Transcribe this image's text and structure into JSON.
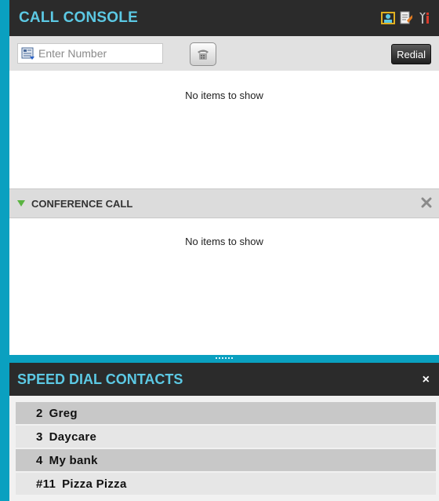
{
  "call_console": {
    "title": "CALL CONSOLE",
    "header_icons": [
      "agent-status-icon",
      "notes-icon",
      "settings-icon"
    ],
    "number_input": {
      "placeholder": "Enter Number",
      "value": ""
    },
    "redial_label": "Redial",
    "empty_text": "No items to show"
  },
  "conference": {
    "title": "CONFERENCE CALL",
    "empty_text": "No items to show"
  },
  "speed_dial": {
    "title": "SPEED DIAL CONTACTS",
    "close_label": "×",
    "contacts": [
      {
        "number": "2",
        "name": "Greg"
      },
      {
        "number": "3",
        "name": "Daycare"
      },
      {
        "number": "4",
        "name": "My bank"
      },
      {
        "number": "#11",
        "name": "Pizza Pizza"
      }
    ]
  },
  "colors": {
    "accent": "#0aa0c0",
    "title_text": "#5cc9e4",
    "titlebar_bg": "#2b2b2b",
    "expand_arrow": "#5ab441"
  }
}
